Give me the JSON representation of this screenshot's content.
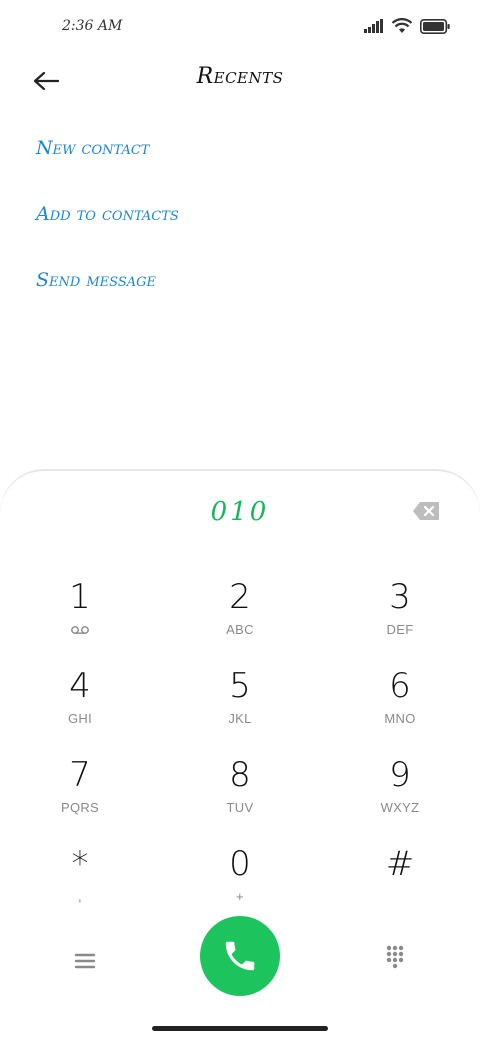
{
  "status_bar": {
    "time": "2:36 AM",
    "icons": [
      "signal-icon",
      "wifi-icon",
      "battery-icon"
    ]
  },
  "header": {
    "title": "Recents",
    "back_icon": "arrow-left-icon"
  },
  "actions": [
    {
      "label": "New contact"
    },
    {
      "label": "Add to contacts"
    },
    {
      "label": "Send message"
    }
  ],
  "dialer": {
    "number": "010",
    "backspace_icon": "backspace-icon",
    "keys": [
      {
        "digit": "1",
        "letters": ""
      },
      {
        "digit": "2",
        "letters": "ABC"
      },
      {
        "digit": "3",
        "letters": "DEF"
      },
      {
        "digit": "4",
        "letters": "GHI"
      },
      {
        "digit": "5",
        "letters": "JKL"
      },
      {
        "digit": "6",
        "letters": "MNO"
      },
      {
        "digit": "7",
        "letters": "PQRS"
      },
      {
        "digit": "8",
        "letters": "TUV"
      },
      {
        "digit": "9",
        "letters": "WXYZ"
      },
      {
        "digit": "*",
        "letters": ","
      },
      {
        "digit": "0",
        "letters": "+"
      },
      {
        "digit": "#",
        "letters": ""
      }
    ],
    "key1_icon": "voicemail-icon",
    "menu_icon": "menu-icon",
    "call_icon": "phone-icon",
    "keypad_icon": "dialpad-icon",
    "colors": {
      "number": "#1ab55c",
      "call_button": "#1dc35d",
      "action_link": "#1f86d6"
    }
  }
}
